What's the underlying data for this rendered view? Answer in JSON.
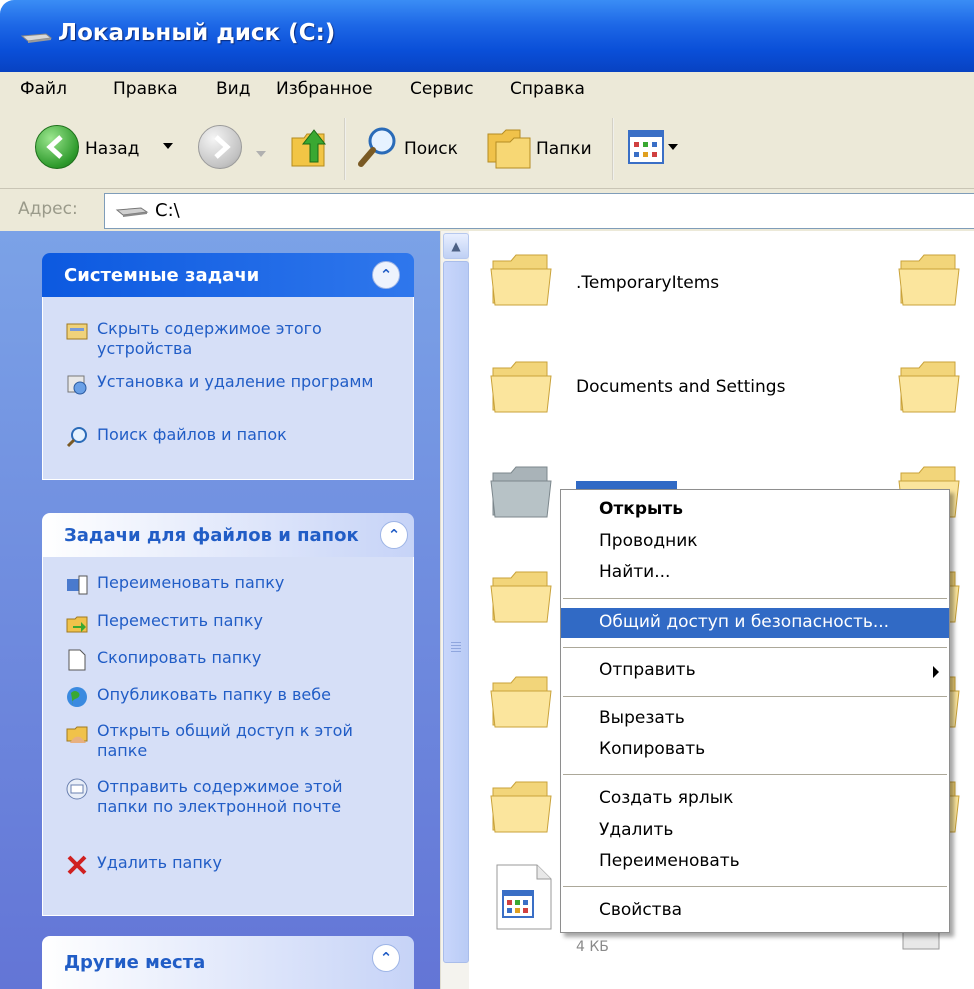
{
  "window": {
    "title": "Локальный диск (C:)"
  },
  "menubar": {
    "items": [
      "Файл",
      "Правка",
      "Вид",
      "Избранное",
      "Сервис",
      "Справка"
    ]
  },
  "toolbar": {
    "back_label": "Назад",
    "search_label": "Поиск",
    "folders_label": "Папки"
  },
  "address": {
    "label": "Адрес:",
    "value": "C:\\"
  },
  "system_tasks": {
    "title": "Системные задачи",
    "items": [
      {
        "label": "Скрыть содержимое этого устройства",
        "icon": "hide-drive-icon"
      },
      {
        "label": "Установка и удаление программ",
        "icon": "add-remove-programs-icon"
      },
      {
        "label": "Поиск файлов и папок",
        "icon": "search-icon"
      }
    ]
  },
  "file_tasks": {
    "title": "Задачи для файлов и папок",
    "items": [
      {
        "label": "Переименовать папку",
        "icon": "rename-icon"
      },
      {
        "label": "Переместить папку",
        "icon": "move-icon"
      },
      {
        "label": "Скопировать папку",
        "icon": "copy-icon"
      },
      {
        "label": "Опубликовать папку в вебе",
        "icon": "globe-icon"
      },
      {
        "label": "Открыть общий доступ к этой папке",
        "icon": "share-folder-icon"
      },
      {
        "label": "Отправить содержимое этой папки по электронной почте",
        "icon": "email-icon"
      },
      {
        "label": "Удалить папку",
        "icon": "delete-icon"
      }
    ]
  },
  "other_places": {
    "title": "Другие места"
  },
  "files": [
    {
      "name": ".TemporaryItems"
    },
    {
      "name": "Documents and Settings"
    },
    {
      "size": "4 КБ"
    }
  ],
  "context_menu": {
    "items": [
      {
        "label": "Открыть",
        "bold": true
      },
      {
        "label": "Проводник"
      },
      {
        "label": "Найти..."
      },
      {
        "label": "Общий доступ и безопасность...",
        "highlighted": true
      },
      {
        "label": "Отправить",
        "submenu": true
      },
      {
        "label": "Вырезать"
      },
      {
        "label": "Копировать"
      },
      {
        "label": "Создать ярлык"
      },
      {
        "label": "Удалить"
      },
      {
        "label": "Переименовать"
      },
      {
        "label": "Свойства"
      }
    ]
  },
  "colors": {
    "titlebar": "#0a4fd8",
    "selection": "#316ac5",
    "task_link": "#215dc6",
    "taskpane_bg": "#6375d6"
  }
}
